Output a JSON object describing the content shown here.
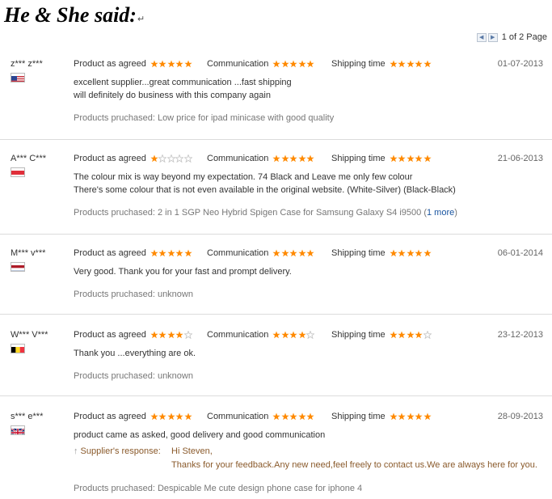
{
  "heading": "He & She said:",
  "heading_mark": "↵",
  "pager": {
    "prev_icon": "arrow-left-icon",
    "next_icon": "arrow-right-icon",
    "text": "1 of 2 Page"
  },
  "labels": {
    "product": "Product as agreed",
    "communication": "Communication",
    "shipping": "Shipping time"
  },
  "colors": {
    "star_on": "#ff8a00",
    "star_off": "#c8c8c8"
  },
  "reviews": [
    {
      "user": "z*** z***",
      "flag": "US",
      "rating_product": 5,
      "rating_communication": 5,
      "rating_shipping": 5,
      "date": "01-07-2013",
      "lines": [
        "excellent supplier...great communication ...fast shipping",
        "will definitely do business with this company again"
      ],
      "purchased": "Products pruchased: Low price for ipad minicase with good quality"
    },
    {
      "user": "A*** C***",
      "flag": "ID",
      "rating_product": 1,
      "rating_communication": 5,
      "rating_shipping": 5,
      "date": "21-06-2013",
      "lines": [
        "The colour mix is way beyond my expectation. 74 Black and Leave me only few colour",
        "There's some colour that is not even available in the original website. (White-Silver) (Black-Black)"
      ],
      "purchased": "Products pruchased: 2 in 1 SGP Neo Hybrid Spigen Case for Samsung Galaxy S4 i9500 (",
      "purchased_more": "1 more",
      "purchased_end": ")"
    },
    {
      "user": "M*** v***",
      "flag": "NL",
      "rating_product": 5,
      "rating_communication": 5,
      "rating_shipping": 5,
      "date": "06-01-2014",
      "lines": [
        "Very good. Thank you for your fast and prompt delivery."
      ],
      "purchased": "Products pruchased: unknown"
    },
    {
      "user": "W*** V***",
      "flag": "BE",
      "rating_product": 4,
      "rating_communication": 4,
      "rating_shipping": 4,
      "date": "23-12-2013",
      "lines": [
        "Thank you ...everything are ok."
      ],
      "purchased": "Products pruchased: unknown"
    },
    {
      "user": "s*** e***",
      "flag": "GB",
      "rating_product": 5,
      "rating_communication": 5,
      "rating_shipping": 5,
      "date": "28-09-2013",
      "lines": [
        "product came as asked, good delivery and good communication"
      ],
      "response_label": "Supplier's response:",
      "response_lines": [
        "Hi Steven,",
        "Thanks for your feedback.Any new need,feel freely to contact us.We are always here for you."
      ],
      "purchased": "Products pruchased: Despicable Me cute design phone case for iphone 4"
    }
  ]
}
